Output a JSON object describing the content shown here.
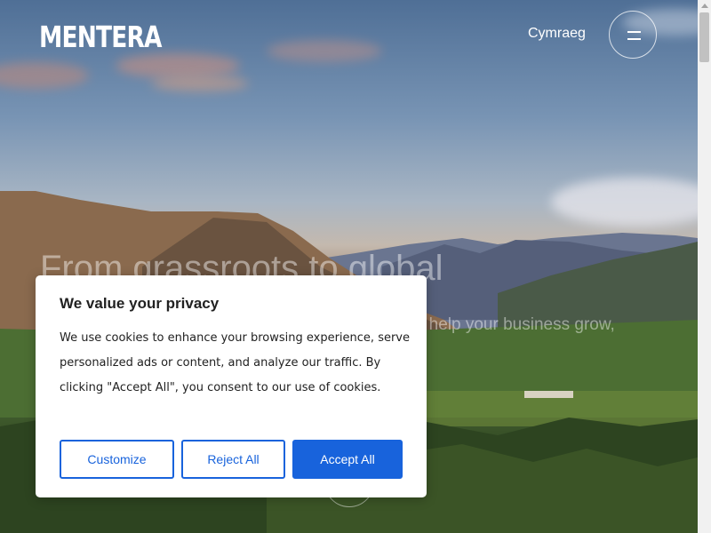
{
  "header": {
    "logo_text": "MENTERA",
    "language_link": "Cymraeg",
    "menu_icon": "hamburger-menu-icon"
  },
  "hero": {
    "title": "From grassroots to global",
    "text": "From start-ups to established busnes, we're here to help your business grow, powered by a movement of thriving"
  },
  "cookie_banner": {
    "title": "We value your privacy",
    "message": "We use cookies to enhance your browsing experience, serve personalized ads or content, and analyze our traffic. By clicking \"Accept All\", you consent to our use of cookies.",
    "buttons": {
      "customize": "Customize",
      "reject": "Reject All",
      "accept": "Accept All"
    }
  },
  "colors": {
    "accent": "#1863dc",
    "banner_text": "#212121",
    "header_text": "#ffffff"
  }
}
